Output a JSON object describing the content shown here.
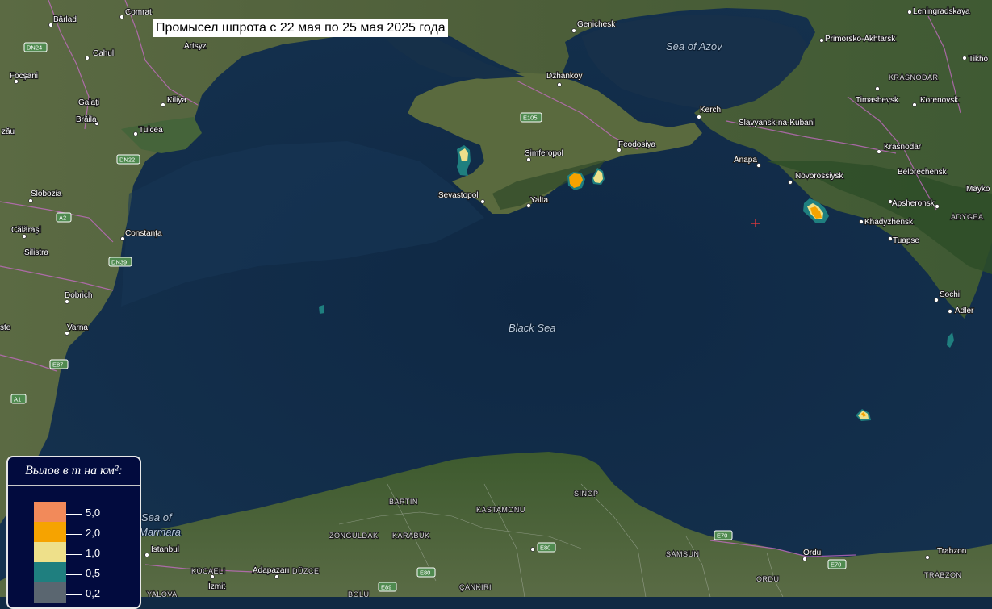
{
  "title": "Промысел шпрота с 22 мая по 25 мая 2025 года",
  "legend": {
    "title": "Вылов в т на км²:",
    "classes": [
      {
        "value": "5,0",
        "color": "#f28a5a"
      },
      {
        "value": "2,0",
        "color": "#f6a300"
      },
      {
        "value": "1,0",
        "color": "#eee08a"
      },
      {
        "value": "0,5",
        "color": "#1f7f7f"
      },
      {
        "value": "0,2",
        "color": "#5a6670"
      }
    ]
  },
  "water_labels": {
    "black_sea": "Black Sea",
    "sea_of_azov": "Sea of Azov",
    "sea_of_marmara_1": "Sea of",
    "sea_of_marmara_2": "Marmara"
  },
  "places": {
    "barlad": "Bârlad",
    "comrat": "Comrat",
    "cahul": "Cahul",
    "artsyz": "Artsyz",
    "focsani": "Focșani",
    "galati": "Galați",
    "braila": "Brăila",
    "kiliya": "Kiliya",
    "tulcea": "Tulcea",
    "zau": "zău",
    "slobozia": "Slobozia",
    "calarasi": "Călărași",
    "silistra": "Silistra",
    "constanta": "Constanța",
    "dobrich": "Dobrich",
    "varna": "Varna",
    "ste": "ste",
    "genichesk": "Genichesk",
    "dzhankoy": "Dzhankoy",
    "simferopol": "Simferopol",
    "feodosiya": "Feodosiya",
    "sevastopol": "Sevastopol",
    "yalta": "Yalta",
    "kerch": "Kerch",
    "slavyansk": "Slavyansk-na-Kubani",
    "anapa": "Anapa",
    "novorossiysk": "Novorossiysk",
    "primorsko": "Primorsko-Akhtarsk",
    "leningradskaya": "Leningradskaya",
    "tikhor": "Tikho",
    "krasnodar_region": "KRASNODAR",
    "timashevsk": "Timashevsk",
    "korenovsk": "Korenovsk",
    "krasnodar": "Krasnodar",
    "belorechensk": "Belorechensk",
    "mayko": "Mayko",
    "apsheronsk": "Apsheronsk",
    "adygea": "ADYGEA",
    "khadyzhensk": "Khadyzhensk",
    "tuapse": "Tuapse",
    "sochi": "Sochi",
    "adler": "Adler",
    "istanbul": "Istanbul",
    "kocaeli": "KOCAELI",
    "izmit": "İzmit",
    "adapazari": "Adapazarı",
    "duzce": "DÜZCE",
    "yalova": "YALOVA",
    "bolu": "BOLU",
    "zonguldak": "ZONGULDAK",
    "karabuk": "KARABÜK",
    "bartin": "BARTIN",
    "kastamonu": "KASTAMONU",
    "sinop": "SINOP",
    "cankiri": "ÇANKIRI",
    "samsun": "SAMSUN",
    "ordu_city": "Ordu",
    "ordu_region": "ORDU",
    "trabzon": "Trabzon",
    "trabzon_region": "TRABZON"
  },
  "roads": {
    "dn24": "DN24",
    "dn22": "DN22",
    "dn39": "DN39",
    "a2": "A2",
    "a1": "A1",
    "e87": "E87",
    "e105": "E105",
    "e70_east": "E70",
    "e70_ordu": "E70",
    "e80_a": "E80",
    "e80_b": "E80",
    "e89": "E89"
  },
  "colors": {
    "sea": "#112a44",
    "land": "#3c5b30",
    "title_bg": "#ffffff",
    "legend_bg": "#020b3e",
    "border_line": "#cc66cc",
    "marker": "#ff3b3b"
  }
}
